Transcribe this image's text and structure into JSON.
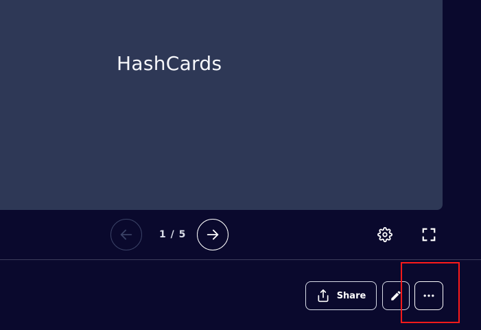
{
  "card": {
    "term": "HashCards"
  },
  "navigation": {
    "counter": "1 / 5",
    "prev_icon": "arrow-left-icon",
    "next_icon": "arrow-right-icon"
  },
  "toolbar": {
    "settings_icon": "gear-icon",
    "fullscreen_icon": "fullscreen-icon"
  },
  "actions": {
    "share_label": "Share",
    "share_icon": "share-icon",
    "edit_icon": "pencil-icon",
    "more_icon": "more-horizontal-icon"
  },
  "colors": {
    "background": "#0a092d",
    "card": "#2e3856",
    "highlight": "#ff1a1a"
  }
}
